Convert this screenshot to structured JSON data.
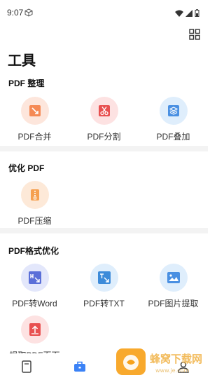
{
  "status": {
    "time": "9:07"
  },
  "title": "工具",
  "sections": {
    "organize": {
      "title": "PDF 整理"
    },
    "optimize": {
      "title": "优化 PDF"
    },
    "format": {
      "title": "PDF格式优化"
    }
  },
  "tools": {
    "merge": {
      "label": "PDF合并"
    },
    "split": {
      "label": "PDF分割"
    },
    "overlay": {
      "label": "PDF叠加"
    },
    "compress": {
      "label": "PDF压缩"
    },
    "to_word": {
      "label": "PDF转Word"
    },
    "to_txt": {
      "label": "PDF转TXT"
    },
    "extract_images": {
      "label": "PDF图片提取"
    },
    "extract_pages": {
      "label": "提取PDF页面"
    }
  },
  "watermark": {
    "text": "蜂窝下载网",
    "subtext": "www.je.com"
  },
  "colors": {
    "orange": "#f58a55",
    "red": "#e85050",
    "blue": "#4a90e2",
    "purple": "#5a6fd8",
    "active_tab": "#3b82f6"
  },
  "icons": {
    "merge": "merge-icon",
    "split": "scissors-icon",
    "overlay": "layers-icon",
    "compress": "zip-icon",
    "to_word": "word-icon",
    "to_txt": "txt-icon",
    "extract_images": "image-icon",
    "extract_pages": "page-extract-icon"
  }
}
